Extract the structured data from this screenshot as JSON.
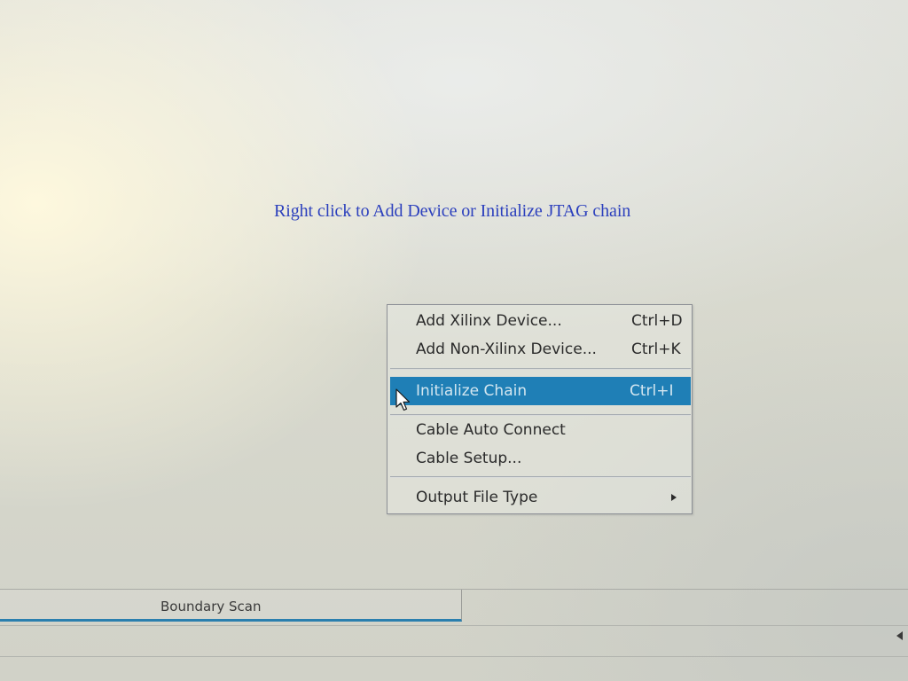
{
  "instruction": {
    "text": "Right click to Add Device or Initialize JTAG chain"
  },
  "context_menu": {
    "items": [
      {
        "label": "Add Xilinx Device...",
        "shortcut": "Ctrl+D"
      },
      {
        "label": "Add Non-Xilinx Device...",
        "shortcut": "Ctrl+K"
      },
      {
        "label": "Initialize Chain",
        "shortcut": "Ctrl+I",
        "highlighted": true
      },
      {
        "label": "Cable Auto Connect"
      },
      {
        "label": "Cable Setup..."
      },
      {
        "label": "Output File Type",
        "submenu_icon": "submenu-arrow-icon"
      }
    ]
  },
  "tabs": [
    {
      "label": "Boundary Scan",
      "active": true
    }
  ],
  "icons": {
    "cursor": "mouse-pointer-icon",
    "submenu": "submenu-arrow-icon",
    "scroll": "scroll-left-arrow-icon"
  },
  "colors": {
    "instruction_text": "#2c40bd",
    "highlight": "#1f7fb6",
    "highlight_text": "#d3e6f0",
    "menu_text": "#2a2a2a",
    "tab_underline": "#2a7fae"
  }
}
